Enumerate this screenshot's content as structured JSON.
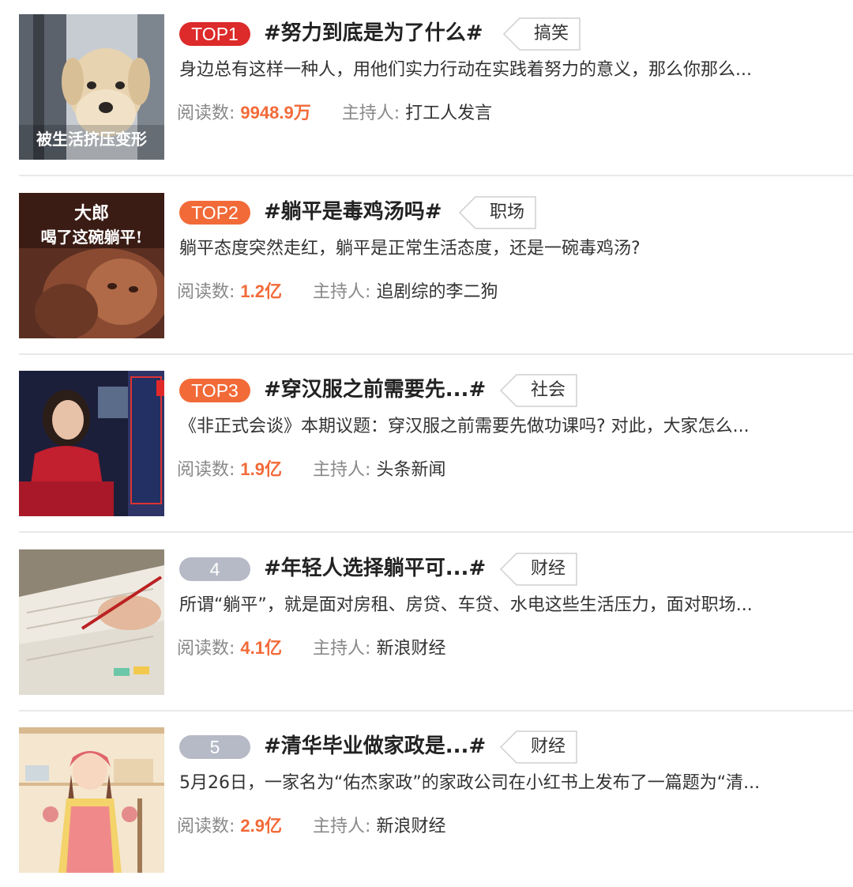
{
  "topics": [
    {
      "rank": "TOP1",
      "title": "#努力到底是为了什么#",
      "tag": "搞笑",
      "description": "身边总有这样一种人，用他们实力行动在实践着努力的意义，那么你那么...",
      "read_label": "阅读数:",
      "read_count": "9948.9万",
      "host_label": "主持人:",
      "host": "打工人发言",
      "thumb_caption": "被生活挤压变形"
    },
    {
      "rank": "TOP2",
      "title": "#躺平是毒鸡汤吗#",
      "tag": "职场",
      "description": "躺平态度突然走红，躺平是正常生活态度，还是一碗毒鸡汤?",
      "read_label": "阅读数:",
      "read_count": "1.2亿",
      "host_label": "主持人:",
      "host": "追剧综的李二狗",
      "thumb_caption_line1": "大郎",
      "thumb_caption_line2": "喝了这碗躺平!"
    },
    {
      "rank": "TOP3",
      "title": "#穿汉服之前需要先...#",
      "tag": "社会",
      "description": "《非正式会谈》本期议题：穿汉服之前需要先做功课吗? 对此，大家怎么...",
      "read_label": "阅读数:",
      "read_count": "1.9亿",
      "host_label": "主持人:",
      "host": "头条新闻"
    },
    {
      "rank": "4",
      "title": "#年轻人选择躺平可...#",
      "tag": "财经",
      "description": "所谓“躺平”，就是面对房租、房贷、车贷、水电这些生活压力，面对职场...",
      "read_label": "阅读数:",
      "read_count": "4.1亿",
      "host_label": "主持人:",
      "host": "新浪财经"
    },
    {
      "rank": "5",
      "title": "#清华毕业做家政是...#",
      "tag": "财经",
      "description": "5月26日，一家名为“佑杰家政”的家政公司在小红书上发布了一篇题为“清...",
      "read_label": "阅读数:",
      "read_count": "2.9亿",
      "host_label": "主持人:",
      "host": "新浪财经"
    }
  ],
  "colors": {
    "top1_badge": "#dd2a2a",
    "top_badge": "#f26a38",
    "plain_badge": "#b6b9c6",
    "read_count": "#f26a38",
    "divider": "#e9e9e9"
  }
}
